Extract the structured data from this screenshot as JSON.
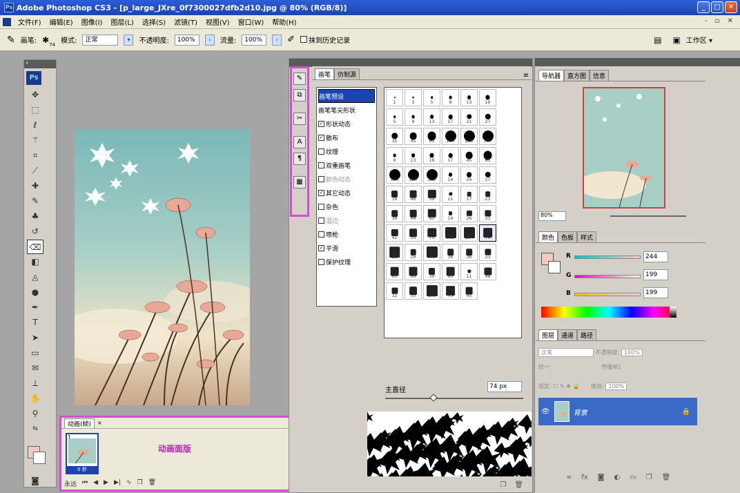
{
  "window": {
    "title": "Adobe Photoshop CS3 - [p_large_JXre_0f7300027dfb2d10.jpg @ 80% (RGB/8)]"
  },
  "menu": [
    "文件(F)",
    "编辑(E)",
    "图像(I)",
    "图层(L)",
    "选择(S)",
    "滤镜(T)",
    "视图(V)",
    "窗口(W)",
    "帮助(H)"
  ],
  "options": {
    "brush_label": "画笔:",
    "brush_size": "74",
    "mode_label": "模式:",
    "mode_value": "正常",
    "opacity_label": "不透明度:",
    "opacity_value": "100%",
    "flow_label": "流量:",
    "flow_value": "100%",
    "history_label": "抹到历史记录",
    "workspace_label": "工作区 ▾"
  },
  "animation": {
    "tab": "动画(帧)",
    "frame_number": "1",
    "frame_time": "0 秒",
    "annotation": "动画面版",
    "loop": "永远"
  },
  "brush": {
    "tabs": [
      "画笔",
      "仿制源"
    ],
    "presets": [
      {
        "label": "画笔预设",
        "state": "selected"
      },
      {
        "label": "画笔笔尖形状",
        "state": "none"
      },
      {
        "label": "形状动态",
        "state": "checked"
      },
      {
        "label": "散布",
        "state": "checked"
      },
      {
        "label": "纹理",
        "state": "unchecked"
      },
      {
        "label": "双重画笔",
        "state": "unchecked"
      },
      {
        "label": "颜色动态",
        "state": "dim"
      },
      {
        "label": "其它动态",
        "state": "checked"
      },
      {
        "label": "杂色",
        "state": "unchecked"
      },
      {
        "label": "湿边",
        "state": "dim"
      },
      {
        "label": "喷枪",
        "state": "unchecked"
      },
      {
        "label": "平滑",
        "state": "checked"
      },
      {
        "label": "保护纹理",
        "state": "unchecked"
      }
    ],
    "tip_sizes": [
      "1",
      "3",
      "5",
      "9",
      "13",
      "19",
      "5",
      "9",
      "13",
      "17",
      "21",
      "27",
      "35",
      "45",
      "65",
      "100",
      "200",
      "300",
      "9",
      "13",
      "19",
      "17",
      "45",
      "65",
      "100",
      "200",
      "300",
      "14",
      "24",
      "27",
      "39",
      "46",
      "59",
      "11",
      "17",
      "23",
      "36",
      "44",
      "60",
      "14",
      "26",
      "33",
      "42",
      "55",
      "70",
      "112",
      "134",
      "74",
      "95",
      "29",
      "192",
      "36",
      "36",
      "33",
      "63",
      "66",
      "39",
      "63",
      "11",
      "48",
      "32",
      "55",
      "100",
      "75",
      "45"
    ],
    "selected_index": 47,
    "diameter_label": "主直径",
    "diameter_value": "74 px"
  },
  "navigator": {
    "tabs": [
      "导航器",
      "直方图",
      "信息"
    ],
    "zoom": "80%"
  },
  "color": {
    "tabs": [
      "颜色",
      "色板",
      "样式"
    ],
    "r_label": "R",
    "r": "244",
    "g_label": "G",
    "g": "199",
    "b_label": "B",
    "b": "199",
    "fg": "#f4c7c7"
  },
  "layers": {
    "tabs": [
      "图层",
      "通道",
      "路径"
    ],
    "blend": "正常",
    "opacity_label": "不透明度:",
    "opacity": "100%",
    "unify_label": "统一:",
    "propagate_label": "传播帧1",
    "lock_label": "锁定:",
    "fill_label": "填充:",
    "fill": "100%",
    "layer_name": "背景"
  }
}
